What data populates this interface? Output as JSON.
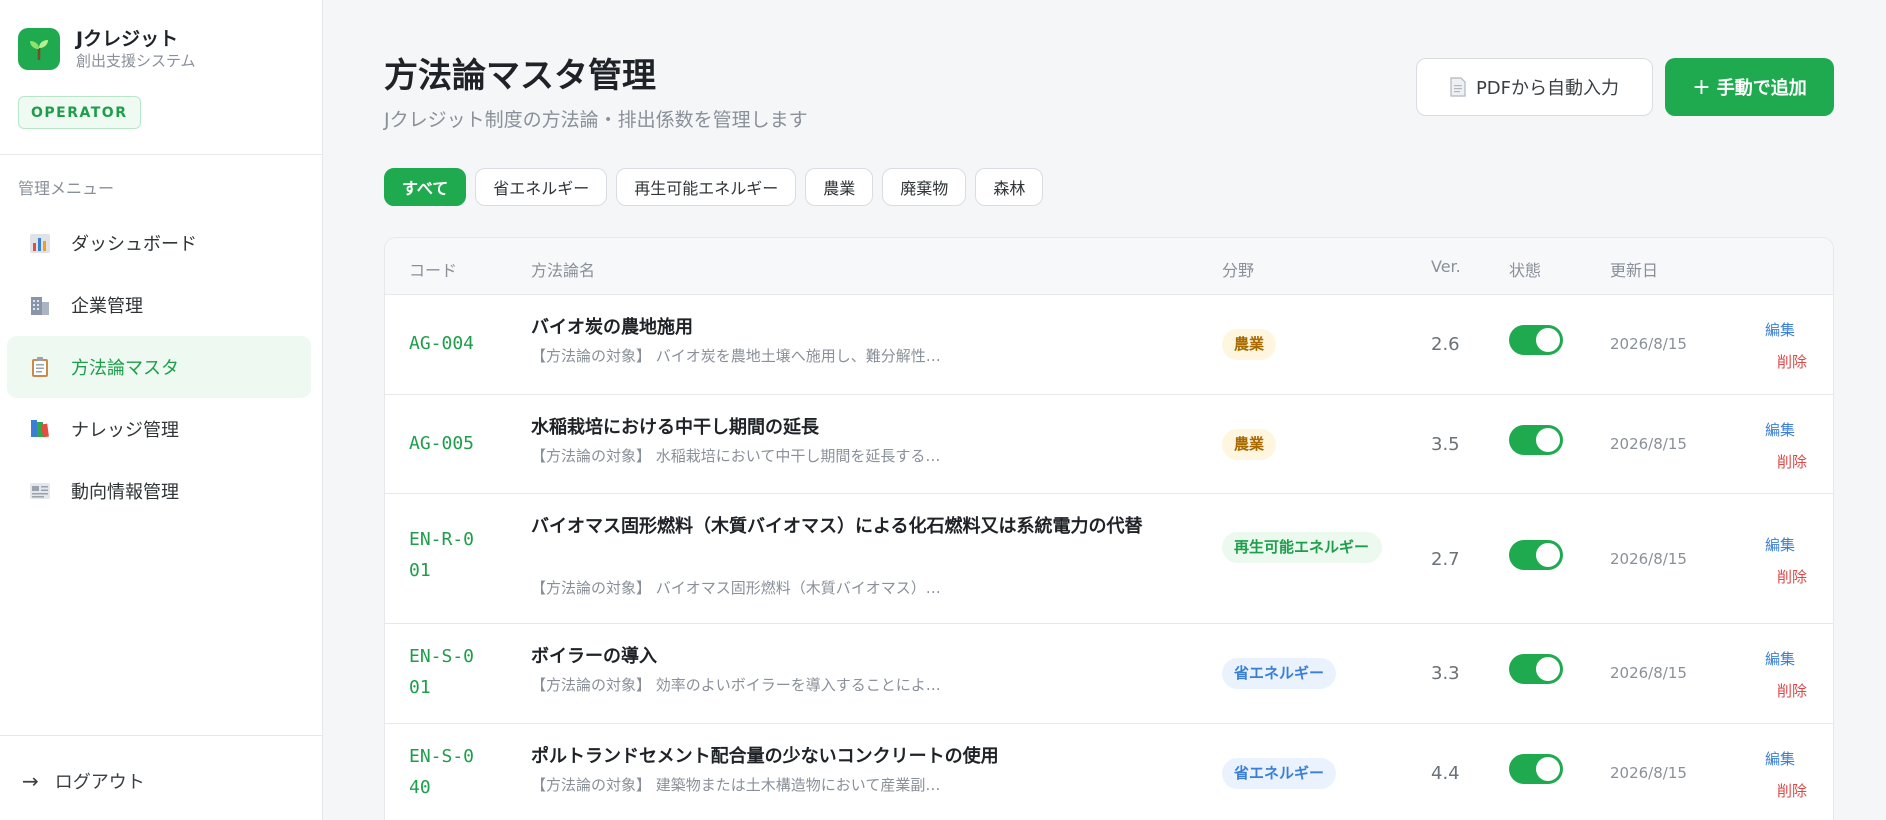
{
  "brand": {
    "title": "Jクレジット",
    "subtitle": "創出支援システム",
    "role": "OPERATOR",
    "logo_icon": "sprout-icon"
  },
  "sidebar": {
    "heading": "管理メニュー",
    "items": [
      {
        "label": "ダッシュボード",
        "icon": "chart-icon",
        "active": false
      },
      {
        "label": "企業管理",
        "icon": "building-icon",
        "active": false
      },
      {
        "label": "方法論マスタ",
        "icon": "clipboard-icon",
        "active": true
      },
      {
        "label": "ナレッジ管理",
        "icon": "books-icon",
        "active": false
      },
      {
        "label": "動向情報管理",
        "icon": "newspaper-icon",
        "active": false
      }
    ],
    "logout": {
      "arrow": "→",
      "label": "ログアウト"
    }
  },
  "header": {
    "title": "方法論マスタ管理",
    "subtitle": "Jクレジット制度の方法論・排出係数を管理します",
    "pdf_button": "PDFから自動入力",
    "add_button_plus": "+",
    "add_button": "手動で追加"
  },
  "filters": [
    "すべて",
    "省エネルギー",
    "再生可能エネルギー",
    "農業",
    "廃棄物",
    "森林"
  ],
  "active_filter": "すべて",
  "table": {
    "headers": {
      "code": "コード",
      "name": "方法論名",
      "field": "分野",
      "ver": "Ver.",
      "status": "状態",
      "updated": "更新日"
    },
    "edit_label": "編集",
    "delete_label": "削除",
    "rows": [
      {
        "code": "AG-004",
        "name": "バイオ炭の農地施用",
        "desc": "【方法論の対象】 バイオ炭を農地土壌へ施用し、難分解性…",
        "field": "農業",
        "field_kind": "agri",
        "ver": "2.6",
        "enabled": true,
        "updated": "2026/8/15"
      },
      {
        "code": "AG-005",
        "name": "水稲栽培における中干し期間の延長",
        "desc": "【方法論の対象】 水稲栽培において中干し期間を延長する…",
        "field": "農業",
        "field_kind": "agri",
        "ver": "3.5",
        "enabled": true,
        "updated": "2026/8/15"
      },
      {
        "code": "EN-R-001",
        "name": "バイオマス固形燃料（木質バイオマス）による化石燃料又は系統電力の代替",
        "desc": "【方法論の対象】 バイオマス固形燃料（木質バイオマス）…",
        "field": "再生可能エネルギー",
        "field_kind": "renew",
        "ver": "2.7",
        "enabled": true,
        "updated": "2026/8/15"
      },
      {
        "code": "EN-S-001",
        "name": "ボイラーの導入",
        "desc": "【方法論の対象】 効率のよいボイラーを導入することによ…",
        "field": "省エネルギー",
        "field_kind": "save",
        "ver": "3.3",
        "enabled": true,
        "updated": "2026/8/15"
      },
      {
        "code": "EN-S-040",
        "name": "ポルトランドセメント配合量の少ないコンクリートの使用",
        "desc": "【方法論の対象】 建築物または土木構造物において産業副…",
        "field": "省エネルギー",
        "field_kind": "save",
        "ver": "4.4",
        "enabled": true,
        "updated": "2026/8/15"
      }
    ]
  },
  "colors": {
    "accent": "#1faa4f",
    "edit": "#3a7fd5",
    "delete": "#e04848"
  }
}
